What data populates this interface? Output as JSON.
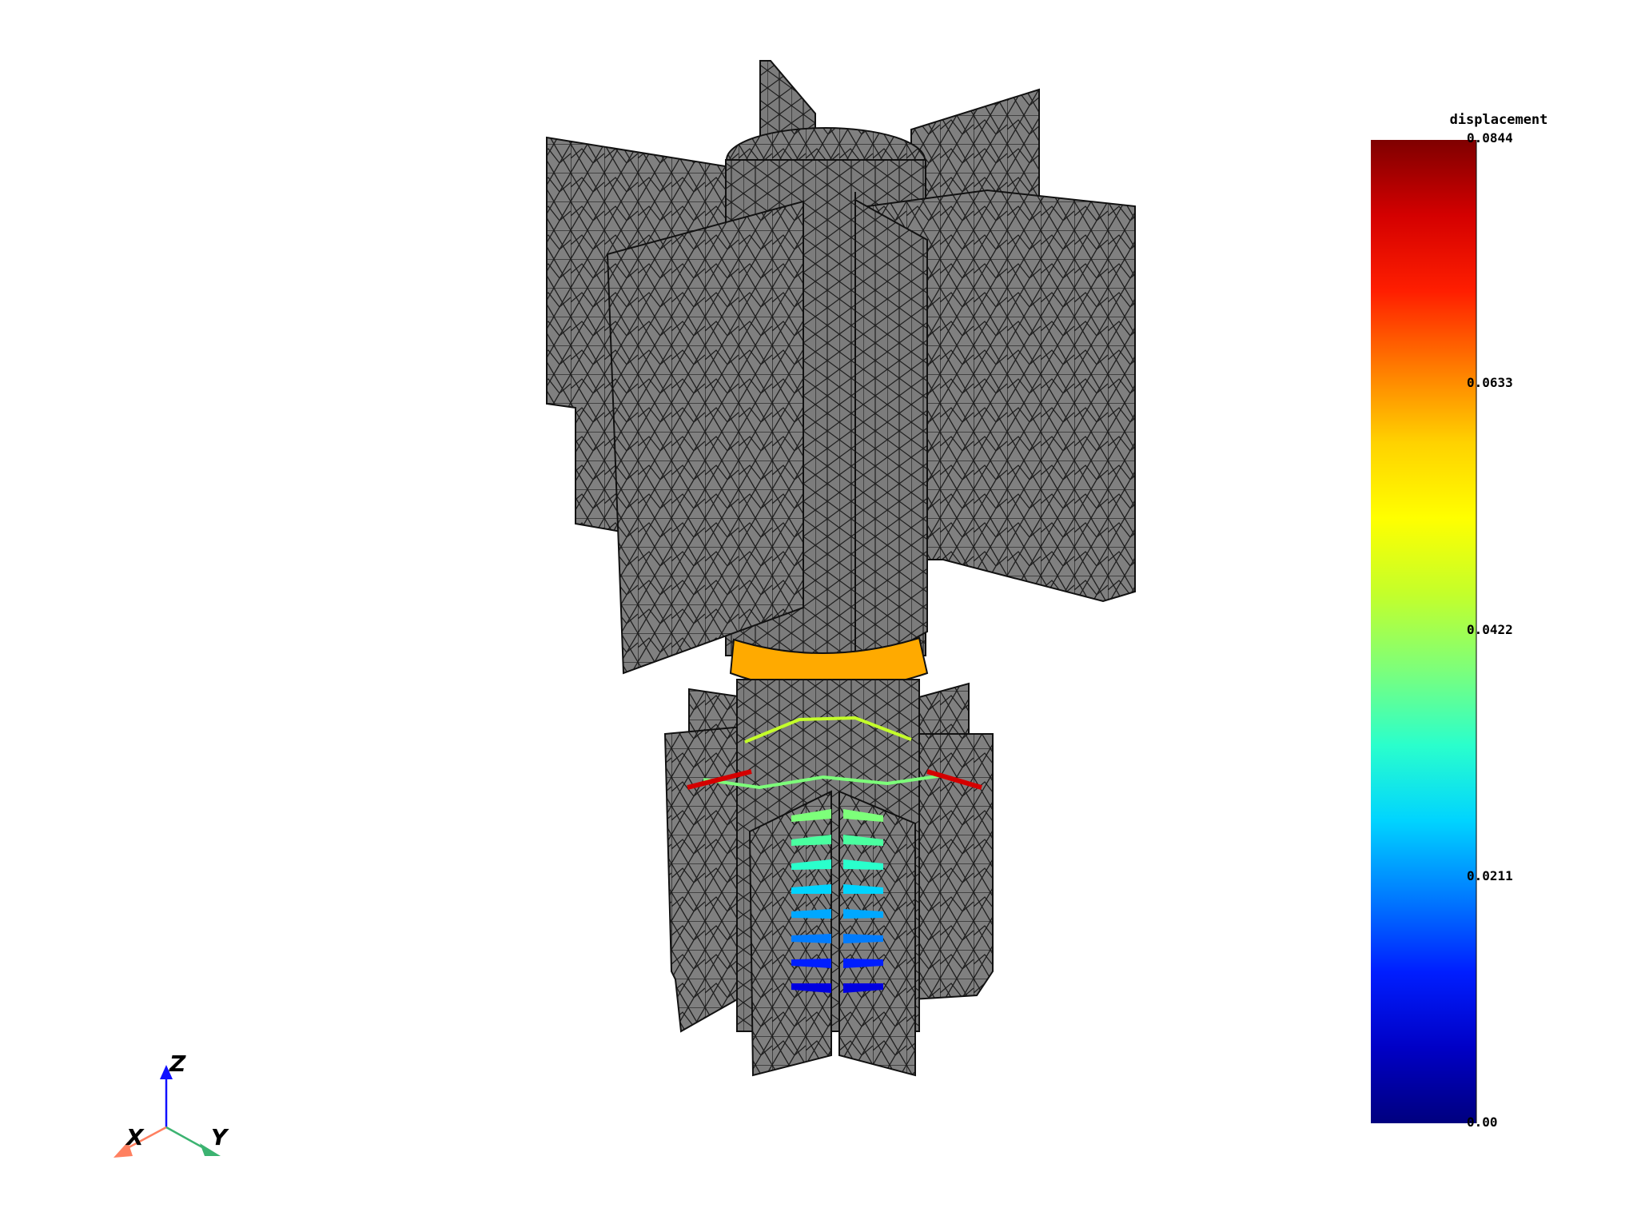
{
  "colorbar": {
    "title": "displacement",
    "ticks": [
      "0.0844",
      "0.0633",
      "0.0422",
      "0.0211",
      "0.00"
    ],
    "colors": [
      "#7f0000",
      "#d40000",
      "#ff1e00",
      "#ff7a00",
      "#ffd200",
      "#ffff00",
      "#c4ff2a",
      "#7dff7a",
      "#2affcc",
      "#00d4ff",
      "#007cff",
      "#001eff",
      "#0000c6",
      "#00007f"
    ]
  },
  "axes": {
    "x": "X",
    "y": "Y",
    "z": "Z"
  },
  "model": {
    "mesh_color": "#808080",
    "edge_color": "#1a1a1a",
    "ring_color": "#ffaa00"
  }
}
